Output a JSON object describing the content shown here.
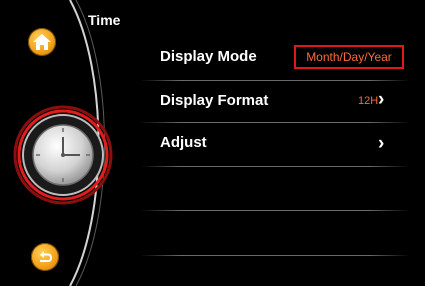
{
  "header": {
    "title": "Time"
  },
  "menu": {
    "items": [
      {
        "label": "Display Mode",
        "value": "Month/Day/Year"
      },
      {
        "label": "Display Format",
        "value": "12H",
        "chevron": "›"
      },
      {
        "label": "Adjust",
        "chevron": "›"
      }
    ]
  },
  "icons": {
    "home": "home-icon",
    "back": "back-icon",
    "clock": "clock-icon"
  },
  "colors": {
    "accent": "#e01818",
    "value_text": "#ff6a3a",
    "button_orange": "#f3a21b",
    "background": "#000000"
  }
}
